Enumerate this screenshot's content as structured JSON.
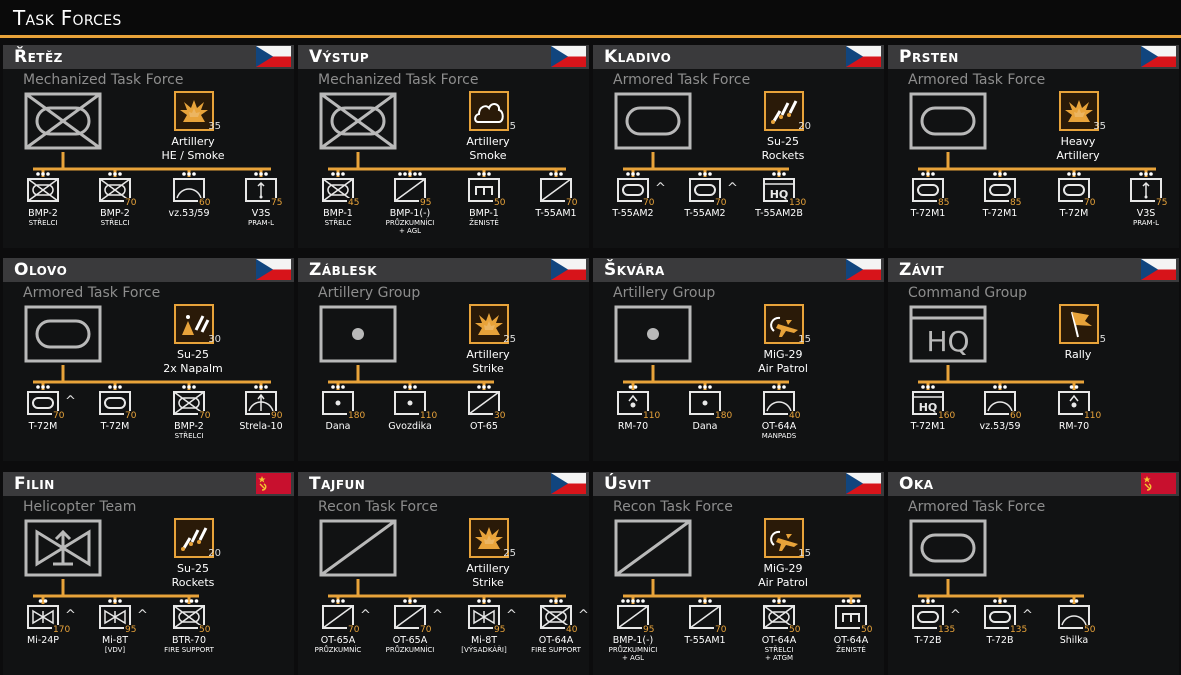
{
  "page_title": "Task Forces",
  "colors": {
    "accent": "#e8a33a",
    "header_bg": "#3a3a3c"
  },
  "cards": [
    {
      "name": "Řetěz",
      "flag": "czech",
      "type": "Mechanized Task Force",
      "main_icon": "mechanized-infantry",
      "support": {
        "icon": "artillery-explosion-icon",
        "count": "35",
        "label": "Artillery\nHE / Smoke"
      },
      "units": [
        {
          "name": "BMP-2",
          "sub": "Střelci",
          "cost": "",
          "icon": "mechinf",
          "dots": 3,
          "chev": false
        },
        {
          "name": "BMP-2",
          "sub": "Střelci",
          "cost": "70",
          "icon": "mechinf",
          "dots": 3,
          "chev": false
        },
        {
          "name": "vz.53/59",
          "sub": "",
          "cost": "60",
          "icon": "aa",
          "dots": 3,
          "chev": false
        },
        {
          "name": "V3S",
          "sub": "PRAM-L",
          "cost": "75",
          "icon": "mortar",
          "dots": 3,
          "chev": false
        }
      ]
    },
    {
      "name": "Výstup",
      "flag": "czech",
      "type": "Mechanized Task Force",
      "main_icon": "mechanized-infantry",
      "support": {
        "icon": "smoke-cloud-icon",
        "count": "5",
        "label": "Artillery\nSmoke"
      },
      "units": [
        {
          "name": "BMP-1",
          "sub": "Střelc",
          "cost": "45",
          "icon": "mechinf",
          "dots": 3,
          "chev": false
        },
        {
          "name": "BMP-1(-)",
          "sub": "Průzkumníci\n+ AGL",
          "cost": "95",
          "icon": "recon",
          "dots": 5,
          "chev": false
        },
        {
          "name": "BMP-1",
          "sub": "Ženisté",
          "cost": "50",
          "icon": "engineer",
          "dots": 3,
          "chev": false
        },
        {
          "name": "T-55AM1",
          "sub": "",
          "cost": "70",
          "icon": "recon",
          "dots": 3,
          "chev": false
        }
      ]
    },
    {
      "name": "Kladivo",
      "flag": "czech",
      "type": "Armored Task Force",
      "main_icon": "armor",
      "support": {
        "icon": "rockets-icon",
        "count": "20",
        "label": "Su-25\nRockets"
      },
      "units": [
        {
          "name": "T-55AM2",
          "sub": "",
          "cost": "70",
          "icon": "armor",
          "dots": 3,
          "chev": true
        },
        {
          "name": "T-55AM2",
          "sub": "",
          "cost": "70",
          "icon": "armor",
          "dots": 3,
          "chev": true
        },
        {
          "name": "T-55AM2B",
          "sub": "",
          "cost": "130",
          "icon": "hq",
          "dots": 3,
          "chev": false
        }
      ]
    },
    {
      "name": "Prsten",
      "flag": "czech",
      "type": "Armored Task Force",
      "main_icon": "armor",
      "support": {
        "icon": "artillery-explosion-icon",
        "count": "35",
        "label": "Heavy\nArtillery"
      },
      "units": [
        {
          "name": "T-72M1",
          "sub": "",
          "cost": "85",
          "icon": "armor",
          "dots": 3,
          "chev": false
        },
        {
          "name": "T-72M1",
          "sub": "",
          "cost": "85",
          "icon": "armor",
          "dots": 3,
          "chev": false
        },
        {
          "name": "T-72M",
          "sub": "",
          "cost": "70",
          "icon": "armor",
          "dots": 3,
          "chev": false
        },
        {
          "name": "V3S",
          "sub": "PRAM-L",
          "cost": "75",
          "icon": "mortar",
          "dots": 3,
          "chev": false
        }
      ]
    },
    {
      "name": "Olovo",
      "flag": "czech",
      "type": "Armored Task Force",
      "main_icon": "armor",
      "support": {
        "icon": "napalm-icon",
        "count": "30",
        "label": "Su-25\n2x Napalm"
      },
      "units": [
        {
          "name": "T-72M",
          "sub": "",
          "cost": "70",
          "icon": "armor",
          "dots": 3,
          "chev": true
        },
        {
          "name": "T-72M",
          "sub": "",
          "cost": "70",
          "icon": "armor",
          "dots": 3,
          "chev": false
        },
        {
          "name": "BMP-2",
          "sub": "Střelci",
          "cost": "70",
          "icon": "mechinf",
          "dots": 3,
          "chev": false
        },
        {
          "name": "Strela-10",
          "sub": "",
          "cost": "90",
          "icon": "aa-missile",
          "dots": 3,
          "chev": false
        }
      ]
    },
    {
      "name": "Záblesk",
      "flag": "czech",
      "type": "Artillery Group",
      "main_icon": "artillery",
      "support": {
        "icon": "artillery-explosion-icon",
        "count": "25",
        "label": "Artillery\nStrike"
      },
      "units": [
        {
          "name": "Dana",
          "sub": "",
          "cost": "180",
          "icon": "artillery",
          "dots": 3,
          "chev": false
        },
        {
          "name": "Gvozdika",
          "sub": "",
          "cost": "110",
          "icon": "artillery",
          "dots": 3,
          "chev": false
        },
        {
          "name": "OT-65",
          "sub": "",
          "cost": "30",
          "icon": "recon",
          "dots": 3,
          "chev": false
        }
      ]
    },
    {
      "name": "Škvára",
      "flag": "czech",
      "type": "Artillery Group",
      "main_icon": "artillery",
      "support": {
        "icon": "air-patrol-icon",
        "count": "15",
        "label": "MiG-29\nAir Patrol"
      },
      "units": [
        {
          "name": "RM-70",
          "sub": "",
          "cost": "110",
          "icon": "rocket-artillery",
          "dots": 2,
          "chev": false
        },
        {
          "name": "Dana",
          "sub": "",
          "cost": "180",
          "icon": "artillery",
          "dots": 3,
          "chev": false
        },
        {
          "name": "OT-64A",
          "sub": "Manpads",
          "cost": "40",
          "icon": "aa",
          "dots": 3,
          "chev": false
        }
      ]
    },
    {
      "name": "Závit",
      "flag": "czech",
      "type": "Command Group",
      "main_icon": "hq",
      "support": {
        "icon": "rally-flag-icon",
        "count": "5",
        "label": "Rally"
      },
      "units": [
        {
          "name": "T-72M1",
          "sub": "",
          "cost": "160",
          "icon": "hq",
          "dots": 3,
          "chev": false
        },
        {
          "name": "vz.53/59",
          "sub": "",
          "cost": "60",
          "icon": "aa",
          "dots": 3,
          "chev": false
        },
        {
          "name": "RM-70",
          "sub": "",
          "cost": "110",
          "icon": "rocket-artillery",
          "dots": 2,
          "chev": false
        }
      ]
    },
    {
      "name": "Filin",
      "flag": "soviet",
      "type": "Helicopter Team",
      "main_icon": "helicopter",
      "support": {
        "icon": "rockets-icon",
        "count": "20",
        "label": "Su-25\nRockets"
      },
      "units": [
        {
          "name": "Mi-24P",
          "sub": "",
          "cost": "170",
          "icon": "helicopter",
          "dots": 2,
          "chev": true
        },
        {
          "name": "Mi-8T",
          "sub": "[VDV]",
          "cost": "95",
          "icon": "helicopter",
          "dots": 3,
          "chev": true
        },
        {
          "name": "BTR-70",
          "sub": "Fire Support",
          "cost": "50",
          "icon": "mechinf",
          "dots": 4,
          "chev": false
        }
      ]
    },
    {
      "name": "Tajfun",
      "flag": "czech",
      "type": "Recon Task Force",
      "main_icon": "recon",
      "support": {
        "icon": "artillery-explosion-icon",
        "count": "25",
        "label": "Artillery\nStrike"
      },
      "units": [
        {
          "name": "OT-65A",
          "sub": "Průzkumníc",
          "cost": "70",
          "icon": "recon",
          "dots": 3,
          "chev": true
        },
        {
          "name": "OT-65A",
          "sub": "Průzkumníci",
          "cost": "70",
          "icon": "recon",
          "dots": 3,
          "chev": true
        },
        {
          "name": "Mi-8T",
          "sub": "[Výsadkáři]",
          "cost": "95",
          "icon": "helicopter",
          "dots": 3,
          "chev": true
        },
        {
          "name": "OT-64A",
          "sub": "Fire Support",
          "cost": "40",
          "icon": "mechinf",
          "dots": 3,
          "chev": true
        }
      ]
    },
    {
      "name": "Úsvit",
      "flag": "czech",
      "type": "Recon Task Force",
      "main_icon": "recon",
      "support": {
        "icon": "air-patrol-icon",
        "count": "15",
        "label": "MiG-29\nAir Patrol"
      },
      "units": [
        {
          "name": "BMP-1(-)",
          "sub": "Průzkumníci\n+ AGL",
          "cost": "95",
          "icon": "recon",
          "dots": 5,
          "chev": false
        },
        {
          "name": "T-55AM1",
          "sub": "",
          "cost": "70",
          "icon": "recon",
          "dots": 3,
          "chev": false
        },
        {
          "name": "OT-64A",
          "sub": "Střelci\n+ ATGM",
          "cost": "50",
          "icon": "mechinf",
          "dots": 3,
          "chev": false
        },
        {
          "name": "OT-64A",
          "sub": "Ženisté",
          "cost": "50",
          "icon": "engineer",
          "dots": 4,
          "chev": false
        }
      ]
    },
    {
      "name": "Oka",
      "flag": "soviet",
      "type": "Armored Task Force",
      "main_icon": "armor",
      "support": null,
      "units": [
        {
          "name": "T-72B",
          "sub": "",
          "cost": "135",
          "icon": "armor",
          "dots": 3,
          "chev": true
        },
        {
          "name": "T-72B",
          "sub": "",
          "cost": "135",
          "icon": "armor",
          "dots": 3,
          "chev": true
        },
        {
          "name": "Shilka",
          "sub": "",
          "cost": "50",
          "icon": "aa",
          "dots": 2,
          "chev": false
        }
      ]
    }
  ]
}
